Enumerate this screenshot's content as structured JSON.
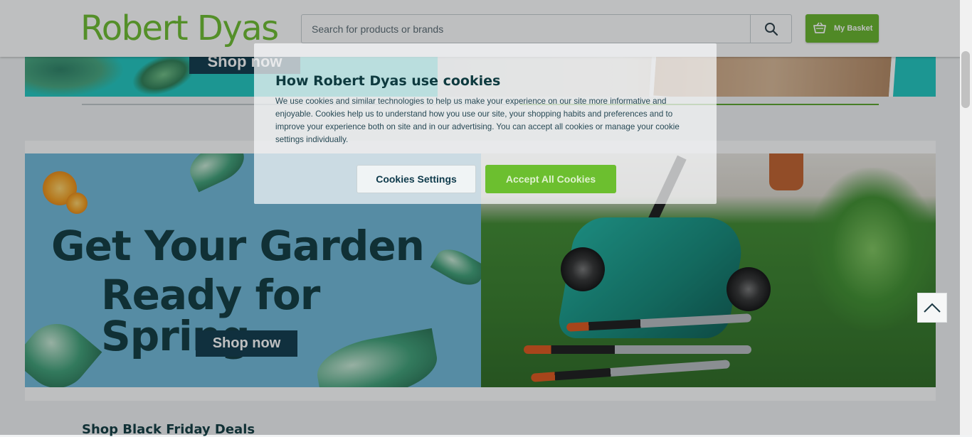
{
  "header": {
    "logo_text": "Robert Dyas",
    "search": {
      "placeholder": "Search for products or brands",
      "value": ""
    },
    "basket_label": "My Basket"
  },
  "top_banner": {
    "cta_label": "Shop now"
  },
  "promo": {
    "title_line1": "Get Your Garden",
    "title_line2": "Ready for Spring",
    "cta_label": "Shop now"
  },
  "section": {
    "title": "Shop Black Friday Deals"
  },
  "cookie_dialog": {
    "title": "How Robert Dyas use cookies",
    "body": "We use cookies and similar technologies to help us make your experience on our site more informative and enjoyable. Cookies help us to understand how you use our site, your shopping habits and preferences and to improve your experience both on site and in our advertising. You can accept all cookies or manage your cookie settings individually.",
    "settings_label": "Cookies Settings",
    "accept_label": "Accept All Cookies"
  },
  "colors": {
    "brand_green": "#6cbd2e",
    "navy": "#0e3a4b",
    "teal": "#1fc7c0"
  },
  "icons": {
    "search": "search-icon",
    "basket": "basket-icon",
    "scroll_top": "chevron-up-icon"
  }
}
